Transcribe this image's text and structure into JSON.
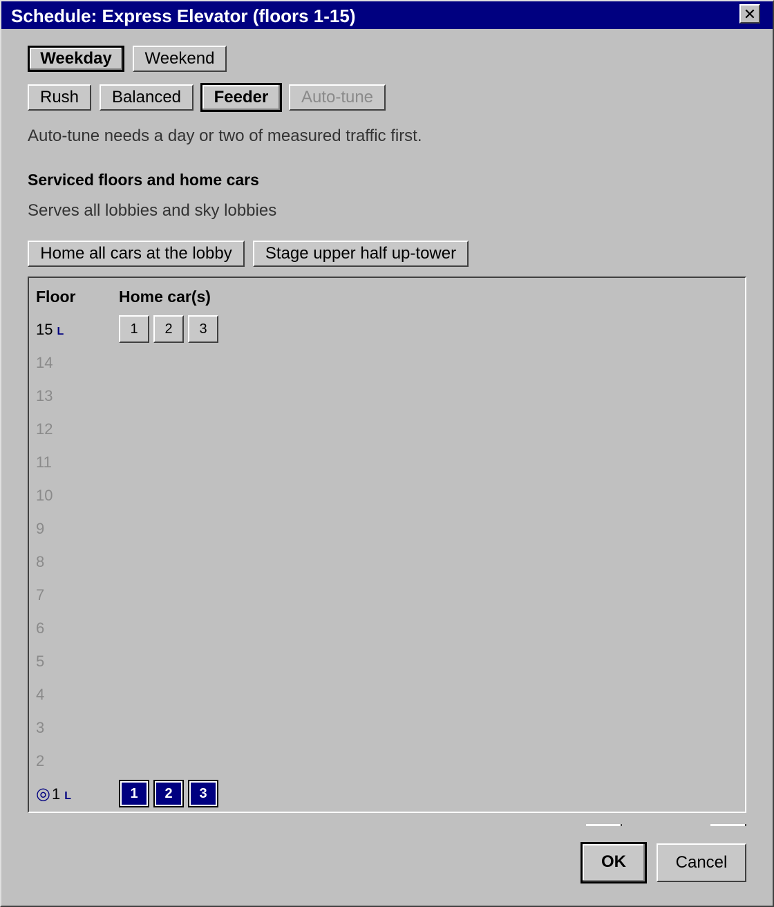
{
  "window": {
    "title": "Schedule: Express Elevator (floors 1-15)",
    "close_glyph": "✕"
  },
  "day_tabs": [
    {
      "label": "Weekday",
      "selected": true
    },
    {
      "label": "Weekend",
      "selected": false
    }
  ],
  "modes": [
    {
      "label": "Rush",
      "selected": false,
      "enabled": true
    },
    {
      "label": "Balanced",
      "selected": false,
      "enabled": true
    },
    {
      "label": "Feeder",
      "selected": true,
      "enabled": true
    },
    {
      "label": "Auto-tune",
      "selected": false,
      "enabled": false
    }
  ],
  "autotune_hint": "Auto-tune needs a day or two of measured traffic first.",
  "section": {
    "heading": "Serviced floors and home cars",
    "subtitle": "Serves all lobbies and sky lobbies"
  },
  "actions": {
    "home_all": "Home all cars at the lobby",
    "stage_upper": "Stage upper half up-tower"
  },
  "table": {
    "col_floor": "Floor",
    "col_home": "Home car(s)",
    "lobby_marker": "L",
    "home_marker": "◎",
    "floors": [
      {
        "label": "15",
        "lobby": true,
        "cars": [
          {
            "label": "1",
            "home": false
          },
          {
            "label": "2",
            "home": false
          },
          {
            "label": "3",
            "home": false
          }
        ]
      },
      {
        "label": "14"
      },
      {
        "label": "13"
      },
      {
        "label": "12"
      },
      {
        "label": "11"
      },
      {
        "label": "10"
      },
      {
        "label": "9"
      },
      {
        "label": "8"
      },
      {
        "label": "7"
      },
      {
        "label": "6"
      },
      {
        "label": "5"
      },
      {
        "label": "4"
      },
      {
        "label": "3"
      },
      {
        "label": "2"
      },
      {
        "label": "1",
        "lobby": true,
        "home_floor": true,
        "cars": [
          {
            "label": "1",
            "home": true
          },
          {
            "label": "2",
            "home": true
          },
          {
            "label": "3",
            "home": true
          }
        ]
      }
    ]
  },
  "footer": {
    "ok": "OK",
    "cancel": "Cancel"
  },
  "colors": {
    "title_bar": "#000080",
    "face": "#c0c0c0",
    "selected_car": "#000080",
    "disabled_text": "#8a8a8a"
  }
}
